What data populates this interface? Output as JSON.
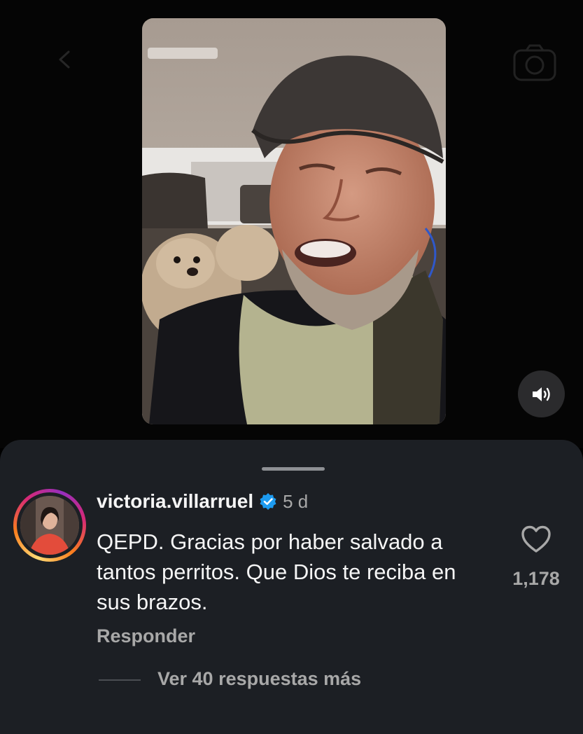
{
  "video": {
    "background_icons": [
      "chevron-left-icon",
      "camera-icon"
    ],
    "sound_icon": "speaker-icon"
  },
  "comment": {
    "username": "victoria.villarruel",
    "verified": true,
    "time": "5 d",
    "text": "QEPD. Gracias por haber salvado a tantos perritos. Que Dios te reciba en sus brazos.",
    "reply_label": "Responder",
    "like_icon": "heart-icon",
    "like_count": "1,178",
    "view_replies_label": "Ver 40 respuestas más"
  },
  "colors": {
    "sheet_background": "#1c1f24",
    "secondary_text": "#a8a8a8",
    "verified_blue": "#1d9bf0",
    "story_ring": [
      "#feda75",
      "#fa7e1e",
      "#d62976",
      "#962fbf"
    ]
  }
}
